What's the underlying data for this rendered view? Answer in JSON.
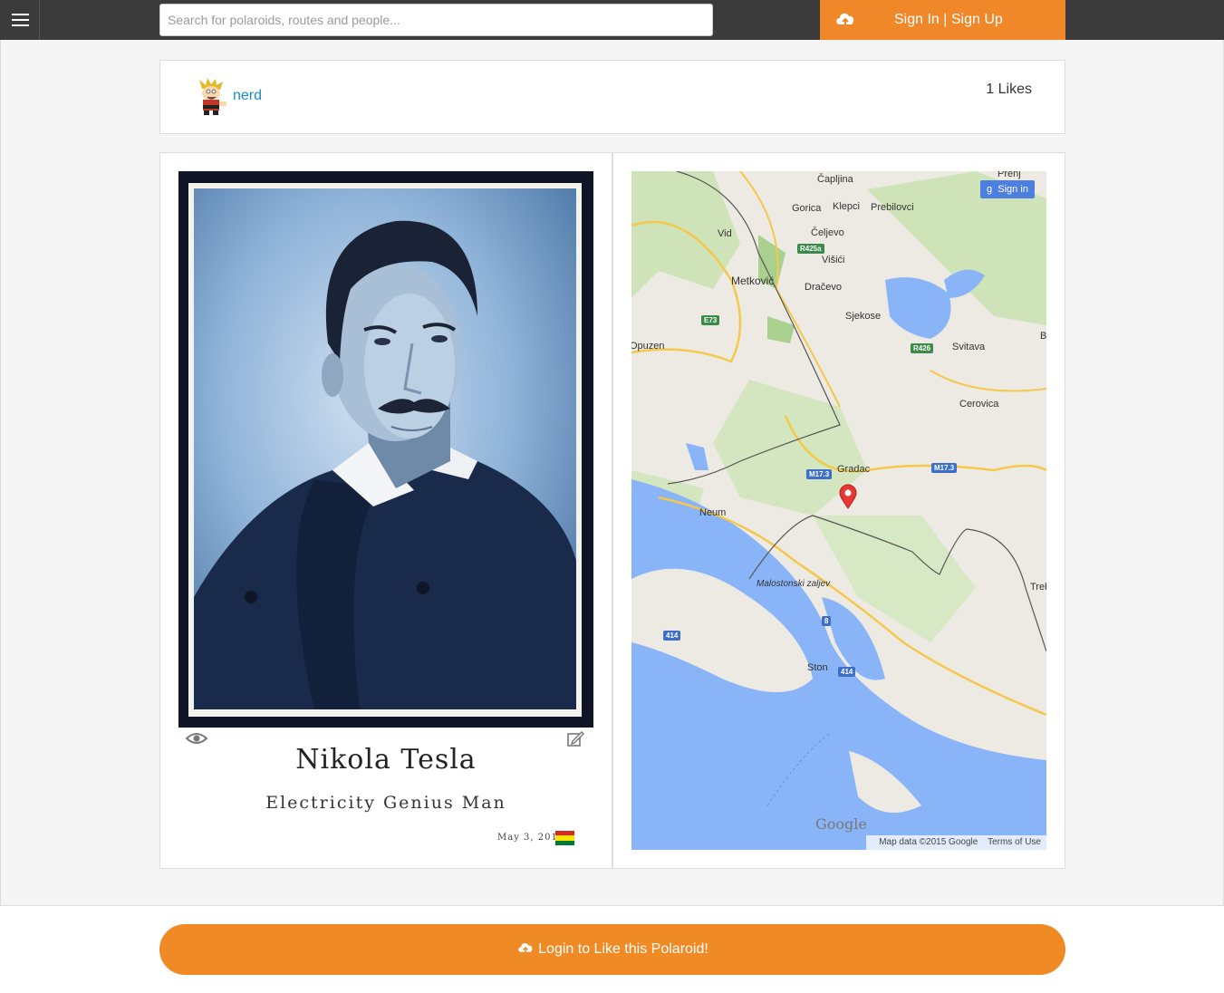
{
  "header": {
    "menu_icon": "hamburger-icon",
    "search_placeholder": "Search for polaroids, routes and people...",
    "upload_icon": "cloud-upload-icon",
    "sign_in": "Sign In",
    "separator": "|",
    "sign_up": "Sign Up",
    "accent_color": "#f0882a"
  },
  "user": {
    "name": "nerd",
    "likes": "1 Likes"
  },
  "polaroid": {
    "title": "Nikola Tesla",
    "caption": "Electricity Genius Man",
    "date": "May 3, 2015",
    "view_icon": "eye-icon",
    "edit_icon": "edit-icon"
  },
  "map": {
    "sign_in": "Sign in",
    "logo": "Google",
    "attribution": "Map data ©2015 Google",
    "terms": "Terms of Use",
    "labels": {
      "capljina": "Čapljina",
      "prenj": "Prenj",
      "gorica": "Gorica",
      "klepci": "Klepci",
      "prebilovci": "Prebilovci",
      "vid": "Vid",
      "celjevo": "Čeljevo",
      "visici": "Višići",
      "metkovic": "Metković",
      "dracevo": "Dračevo",
      "sjekose": "Sjekose",
      "opuzen": "Opuzen",
      "svitava": "Svitava",
      "cerovica": "Cerovica",
      "gradac": "Gradac",
      "neum": "Neum",
      "malostonski": "Malostonski zaljev",
      "ston": "Ston",
      "treb": "Treb",
      "b": "B"
    },
    "shields": {
      "r425a": "R425a",
      "e73": "E73",
      "r426": "R426",
      "m173a": "M17.3",
      "m173b": "M17.3",
      "s8": "8",
      "s414a": "414",
      "s414b": "414"
    }
  },
  "login_button": "Login to Like this Polaroid!"
}
